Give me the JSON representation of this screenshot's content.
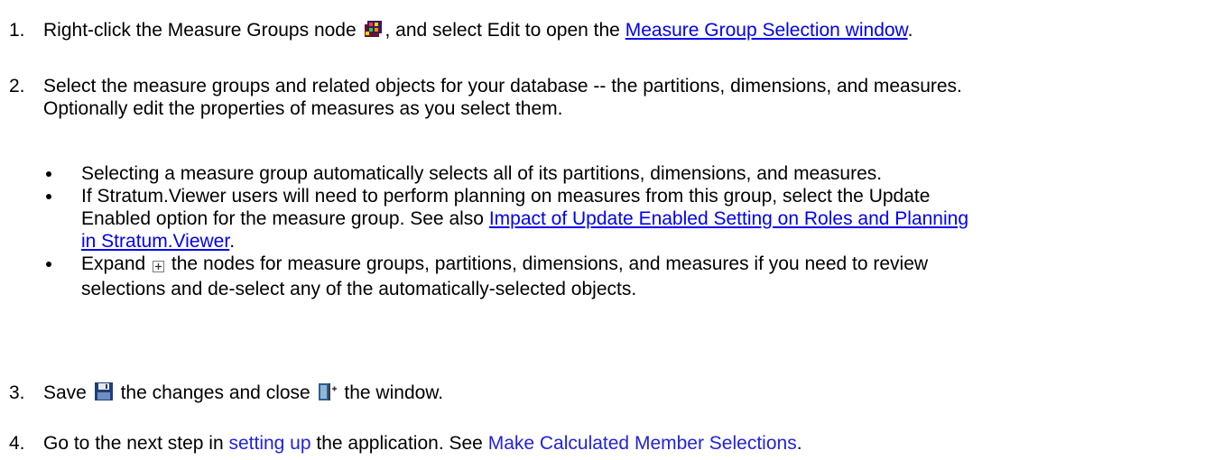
{
  "colors": {
    "link": "#0000ee",
    "plain_link": "#2222dd",
    "text": "#000000"
  },
  "steps": [
    {
      "number": "1.",
      "text_a": "Right-click the Measure Groups node",
      "icon": "measure-groups-icon",
      "text_b": ", and select Edit to open the",
      "link": "Measure Group Selection window",
      "text_c": "."
    },
    {
      "number": "2.",
      "line1": "Select the measure groups and related objects for your database -- the partitions, dimensions, and measures.",
      "line2": "Optionally edit the properties of measures as you select them.",
      "bullets": [
        {
          "line1": "Selecting a measure group automatically selects all of its partitions, dimensions, and measures."
        },
        {
          "line1": "If Stratum.Viewer users will need to perform planning on measures from this group, select the Update",
          "line2_text": "Enabled option for the measure group. See also",
          "link_part1": "Impact of Update Enabled Setting on Roles and Planning",
          "link_part2": "in Stratum.Viewer",
          "line3_tail": "."
        },
        {
          "line1_a": "Expand",
          "icon": "expand-plus-icon",
          "line1_b": "the nodes for measure groups, partitions, dimensions, and measures if you need to review",
          "line2": "selections and de-select any of the automatically-selected objects."
        }
      ]
    },
    {
      "number": "3.",
      "text_a": "Save",
      "save_icon": "save-floppy-icon",
      "text_b": "the changes and close",
      "close_icon": "exit-door-icon",
      "text_c": "the window."
    },
    {
      "number": "4.",
      "text_a": "Go to the next step in",
      "link1": "setting up",
      "text_b": "the application. See",
      "link2": "Make Calculated Member Selections",
      "text_c": "."
    }
  ]
}
